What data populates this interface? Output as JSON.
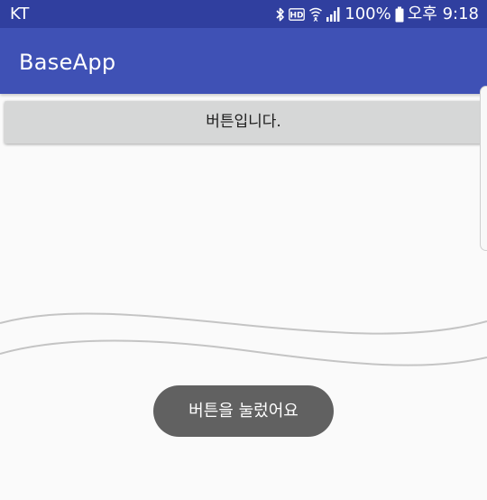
{
  "status_bar": {
    "carrier": "KT",
    "hd_label": "HD",
    "battery_percent": "100%",
    "time": "오후 9:18",
    "icons": [
      "bluetooth-icon",
      "hd-voice-icon",
      "wifi-icon",
      "signal-icon",
      "battery-icon"
    ],
    "battery_level": 1.0
  },
  "app_bar": {
    "title": "BaseApp"
  },
  "main": {
    "button_label": "버튼입니다."
  },
  "toast": {
    "message": "버튼을 눌렀어요"
  },
  "colors": {
    "status_bar": "#303f9f",
    "app_bar": "#3f51b5",
    "background": "#fafafa",
    "button": "#d6d7d7",
    "toast": "#616161"
  }
}
